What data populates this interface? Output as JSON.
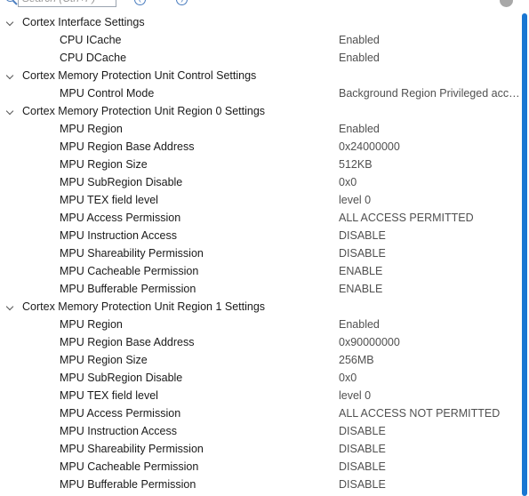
{
  "toolbar": {
    "search_placeholder": "Search (Ctrl+F)",
    "icons": [
      "search-icon",
      "navigate-back-icon",
      "navigate-forward-icon",
      "info-icon"
    ]
  },
  "groups": [
    {
      "title": "Cortex Interface Settings",
      "props": [
        {
          "name": "CPU ICache",
          "value": "Enabled"
        },
        {
          "name": "CPU DCache",
          "value": "Enabled"
        }
      ]
    },
    {
      "title": "Cortex Memory Protection Unit Control Settings",
      "props": [
        {
          "name": "MPU Control Mode",
          "value": "Background Region Privileged accesses only + MPU Disabled during hard fault, NMI and FAULTMASK handlers"
        }
      ]
    },
    {
      "title": "Cortex Memory Protection Unit Region 0 Settings",
      "props": [
        {
          "name": "MPU Region",
          "value": "Enabled"
        },
        {
          "name": "MPU Region Base Address",
          "value": "0x24000000"
        },
        {
          "name": "MPU Region Size",
          "value": "512KB"
        },
        {
          "name": "MPU SubRegion Disable",
          "value": "0x0"
        },
        {
          "name": "MPU TEX field level",
          "value": "level 0"
        },
        {
          "name": "MPU Access Permission",
          "value": "ALL ACCESS PERMITTED"
        },
        {
          "name": "MPU Instruction Access",
          "value": "DISABLE"
        },
        {
          "name": "MPU Shareability Permission",
          "value": "DISABLE"
        },
        {
          "name": "MPU Cacheable Permission",
          "value": "ENABLE"
        },
        {
          "name": "MPU Bufferable  Permission",
          "value": "ENABLE"
        }
      ]
    },
    {
      "title": "Cortex Memory Protection Unit Region 1 Settings",
      "props": [
        {
          "name": "MPU Region",
          "value": "Enabled"
        },
        {
          "name": "MPU Region Base Address",
          "value": "0x90000000"
        },
        {
          "name": "MPU Region Size",
          "value": "256MB"
        },
        {
          "name": "MPU SubRegion Disable",
          "value": "0x0"
        },
        {
          "name": "MPU TEX field level",
          "value": "level 0"
        },
        {
          "name": "MPU Access Permission",
          "value": "ALL ACCESS NOT PERMITTED"
        },
        {
          "name": "MPU Instruction Access",
          "value": "DISABLE"
        },
        {
          "name": "MPU Shareability Permission",
          "value": "DISABLE"
        },
        {
          "name": "MPU Cacheable Permission",
          "value": "DISABLE"
        },
        {
          "name": "MPU Bufferable  Permission",
          "value": "DISABLE"
        }
      ]
    }
  ],
  "colors": {
    "accent": "#1976d2",
    "icon_blue": "#4a7dbf",
    "value_text": "#505050"
  }
}
